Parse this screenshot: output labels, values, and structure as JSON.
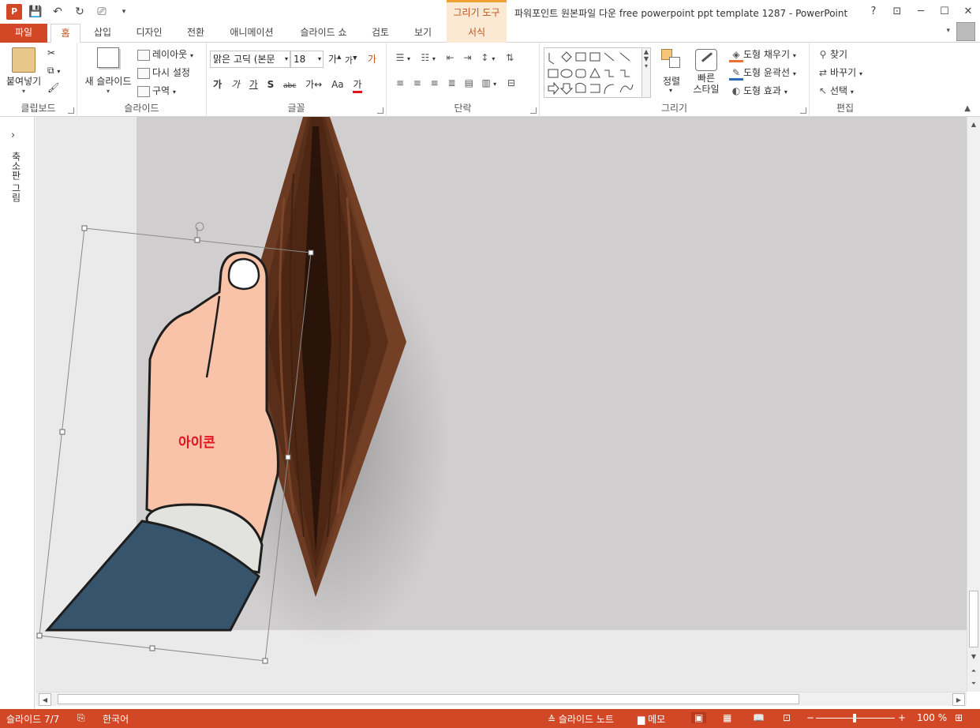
{
  "window": {
    "title": "파워포인트 원본파일 다운 free powerpoint ppt template 1287 - PowerPoint",
    "context_tab_group": "그리기 도구",
    "help": "?",
    "ribbon_display": "⊡",
    "minimize": "─",
    "maximize": "☐",
    "close": "✕"
  },
  "tabs": {
    "file": "파일",
    "items": [
      "홈",
      "삽입",
      "디자인",
      "전환",
      "애니메이션",
      "슬라이드 쇼",
      "검토",
      "보기"
    ],
    "context": "서식"
  },
  "ribbon": {
    "clipboard": {
      "label": "클립보드",
      "paste": "붙여넣기"
    },
    "slides": {
      "label": "슬라이드",
      "new_slide": "새 슬라이드",
      "layout": "레이아웃",
      "reset": "다시 설정",
      "section": "구역"
    },
    "font": {
      "label": "글꼴",
      "font_name": "맑은 고딕 (본문",
      "font_size": "18",
      "grow": "가",
      "shrink": "가",
      "clear": "가",
      "bold": "가",
      "italic": "가",
      "underline": "가",
      "shadow": "S",
      "strike": "abc",
      "spacing": "가↔",
      "case": "Aa",
      "color": "가"
    },
    "paragraph": {
      "label": "단락"
    },
    "drawing": {
      "label": "그리기",
      "arrange": "정렬",
      "quick_styles": "빠른\n스타일",
      "quick_styles_1": "빠른",
      "quick_styles_2": "스타일",
      "fill": "도형 채우기",
      "outline": "도형 윤곽선",
      "effects": "도형 효과"
    },
    "editing": {
      "label": "편집",
      "find": "찾기",
      "replace": "바꾸기",
      "select": "선택"
    }
  },
  "thumbnail_pane": {
    "label": "축소판 그림"
  },
  "slide": {
    "caption": "아이콘"
  },
  "status": {
    "slide_counter": "슬라이드 7/7",
    "language": "한국어",
    "notes": "슬라이드 노트",
    "comments": "메모",
    "zoom": "100 %"
  },
  "colors": {
    "accent": "#d24726",
    "context_tab": "#f0a030",
    "wallet": "#6b3a22",
    "skin": "#f8c3a8",
    "sleeve": "#37546d",
    "caption": "#e3121e"
  }
}
